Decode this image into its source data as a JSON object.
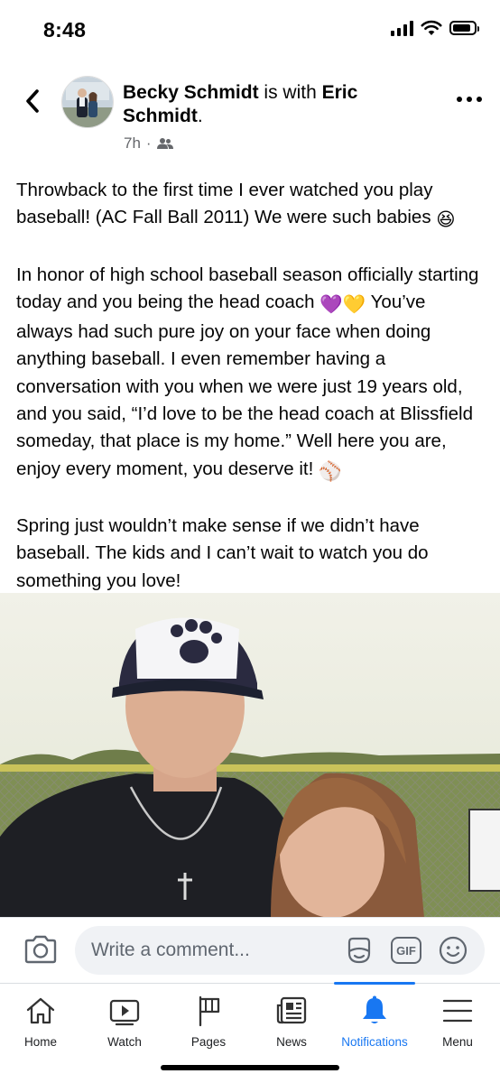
{
  "status_bar": {
    "time": "8:48"
  },
  "post": {
    "author": "Becky Schmidt",
    "with_text": " is with ",
    "tagged": "Eric Schmidt",
    "tagged_suffix": ".",
    "timestamp": "7h",
    "separator": "·",
    "audience_icon": "friends-icon",
    "paragraphs": {
      "p1": "Throwback to the first time I ever watched you play baseball! (AC Fall Ball 2011) We were such babies",
      "p2a": "In honor of high school baseball season officially starting today and you being the head coach",
      "p2b": "You’ve always had such pure joy on your face when doing anything baseball. I even remember having a conversation with you when we were just 19 years old, and you said, “I’d love to be the head coach at Blissfield someday, that place is my home.” Well here you are, enjoy every moment, you deserve it!",
      "p3": "Spring just wouldn’t make sense if we didn’t have baseball. The kids and I can’t wait to watch you do something you love!"
    },
    "emojis": {
      "laugh": "😆",
      "purple_heart": "💜",
      "yellow_heart": "💛",
      "baseball": "⚾"
    }
  },
  "comment_bar": {
    "placeholder": "Write a comment...",
    "gif_label": "GIF"
  },
  "tabs": [
    {
      "label": "Home",
      "icon": "home-icon"
    },
    {
      "label": "Watch",
      "icon": "watch-icon"
    },
    {
      "label": "Pages",
      "icon": "flag-icon"
    },
    {
      "label": "News",
      "icon": "news-icon"
    },
    {
      "label": "Notifications",
      "icon": "bell-icon",
      "active": true
    },
    {
      "label": "Menu",
      "icon": "menu-icon"
    }
  ],
  "colors": {
    "accent": "#1877f2",
    "secondary_text": "#65676b",
    "input_bg": "#f0f2f5"
  }
}
